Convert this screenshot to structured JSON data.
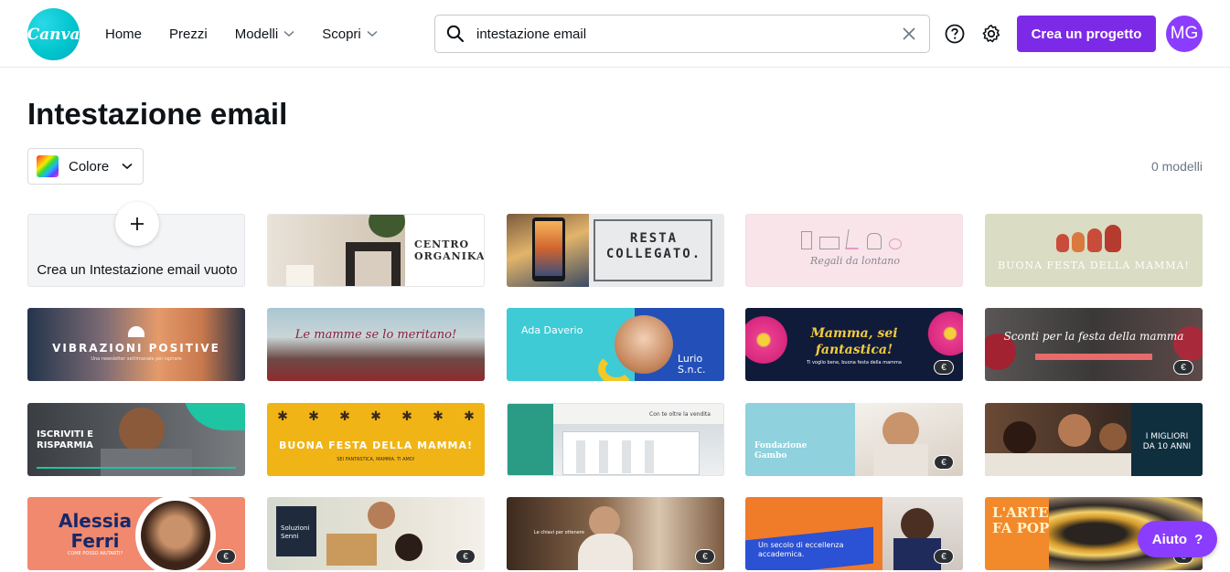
{
  "header": {
    "logo_text": "Canva",
    "nav": [
      {
        "label": "Home"
      },
      {
        "label": "Prezzi"
      },
      {
        "label": "Modelli"
      },
      {
        "label": "Scopri"
      }
    ],
    "search": {
      "value": "intestazione email",
      "placeholder": ""
    },
    "create_button": "Crea un progetto",
    "avatar_initials": "MG",
    "accent": "#7d2ae8"
  },
  "page": {
    "title": "Intestazione email",
    "color_filter_label": "Colore",
    "count_label": "0 modelli",
    "new_tile_label": "Crea un Intestazione email vuoto"
  },
  "templates": [
    {
      "id": "t1",
      "text": [
        "CENTRO",
        "ORGANIKA"
      ]
    },
    {
      "id": "t2",
      "text": [
        "RESTA",
        "COLLEGATO."
      ]
    },
    {
      "id": "t3",
      "text": [
        "Regali da lontano"
      ]
    },
    {
      "id": "t4",
      "text": [
        "BUONA FESTA DELLA MAMMA!"
      ]
    },
    {
      "id": "t5",
      "text": [
        "VIBRAZIONI POSITIVE",
        "Una newsletter settimanale per ispirare"
      ]
    },
    {
      "id": "t6",
      "text": [
        "Le mamme se lo meritano!"
      ]
    },
    {
      "id": "t7",
      "text": [
        "Ada Daverio",
        "Lurio",
        "S.n.c."
      ]
    },
    {
      "id": "t8",
      "text": [
        "Mamma, sei",
        "fantastica!",
        "Ti voglio bene, buona festa della mamma"
      ],
      "premium": true
    },
    {
      "id": "t9",
      "text": [
        "Sconti per la festa della mamma"
      ],
      "premium": true
    },
    {
      "id": "t10",
      "text": [
        "ISCRIVITI E",
        "RISPARMIA"
      ]
    },
    {
      "id": "t11",
      "text": [
        "BUONA FESTA DELLA MAMMA!",
        "SEI FANTASTICA, MAMMA. TI AMO!"
      ]
    },
    {
      "id": "t12",
      "text": [
        "Con te oltre la vendita"
      ]
    },
    {
      "id": "t13",
      "text": [
        "Fondazione",
        "Gambo"
      ],
      "premium": true
    },
    {
      "id": "t14",
      "text": [
        "I MIGLIORI",
        "DA 10 ANNI"
      ]
    },
    {
      "id": "t15",
      "text": [
        "Alessia",
        "Ferri",
        "COME POSSO AIUTARTI?"
      ],
      "premium": true
    },
    {
      "id": "t16",
      "text": [
        "Soluzioni",
        "Senni"
      ],
      "premium": true
    },
    {
      "id": "t17",
      "text": [
        "Le chiavi per ottenere"
      ],
      "premium": true
    },
    {
      "id": "t18",
      "text": [
        "Un secolo di eccellenza",
        "accademica."
      ],
      "premium": true
    },
    {
      "id": "t19",
      "text": [
        "L'ARTE",
        "FA POP"
      ],
      "premium": true
    }
  ],
  "premium_badge": "€",
  "help_button": {
    "label": "Aiuto",
    "icon": "?"
  }
}
